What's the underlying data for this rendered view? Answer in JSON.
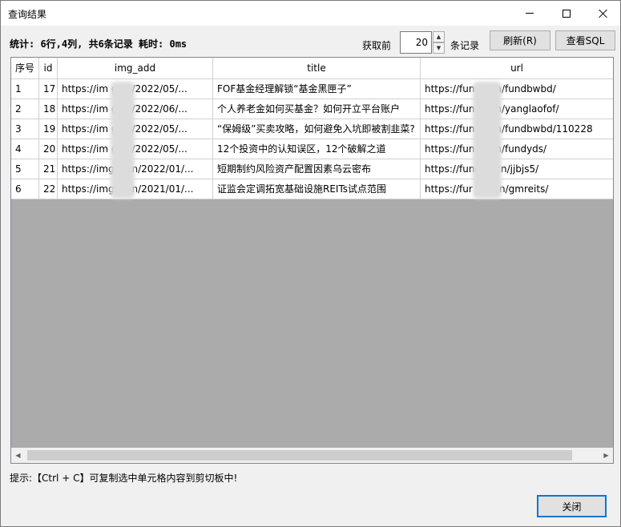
{
  "window": {
    "title": "查询结果"
  },
  "toolbar": {
    "stats": "统计: 6行,4列, 共6条记录 耗时: 0ms",
    "fetch_label": "获取前",
    "fetch_count": "20",
    "unit_label": "条记录",
    "refresh_label": "刷新(R)",
    "view_sql_label": "查看SQL"
  },
  "table": {
    "columns": [
      "序号",
      "id",
      "img_add",
      "title",
      "url"
    ],
    "rows": [
      [
        "1",
        "17",
        "https://im      g.cn/2022/05/...",
        "FOF基金经理解锁“基金黑匣子”",
        "https://fun        m.cn/fundbwbd/"
      ],
      [
        "2",
        "18",
        "https://im      g.cn/2022/06/...",
        "个人养老金如何买基金？如何开立平台账户",
        "https://fun        m.cn/yanglaofof/"
      ],
      [
        "3",
        "19",
        "https://im      g.cn/2022/05/...",
        "“保姆级”买卖攻略，如何避免入坑即被割韭菜?",
        "https://fun        m.cn/fundbwbd/110228"
      ],
      [
        "4",
        "20",
        "https://im      g.cn/2022/05/...",
        "12个投资中的认知误区，12个破解之道",
        "https://fun        m.cn/fundyds/"
      ],
      [
        "5",
        "21",
        "https://img      g.cn/2022/01/...",
        "短期制约风险资产配置因素乌云密布",
        "https://func        m.cn/jjbjs5/"
      ],
      [
        "6",
        "22",
        "https://img      g.cn/2021/01/...",
        "证监会定调拓宽基础设施REITs试点范围",
        "https://fur        om.cn/gmreits/"
      ]
    ]
  },
  "hint": "提示:【Ctrl + C】可复制选中单元格内容到剪切板中!",
  "close_label": "关闭"
}
